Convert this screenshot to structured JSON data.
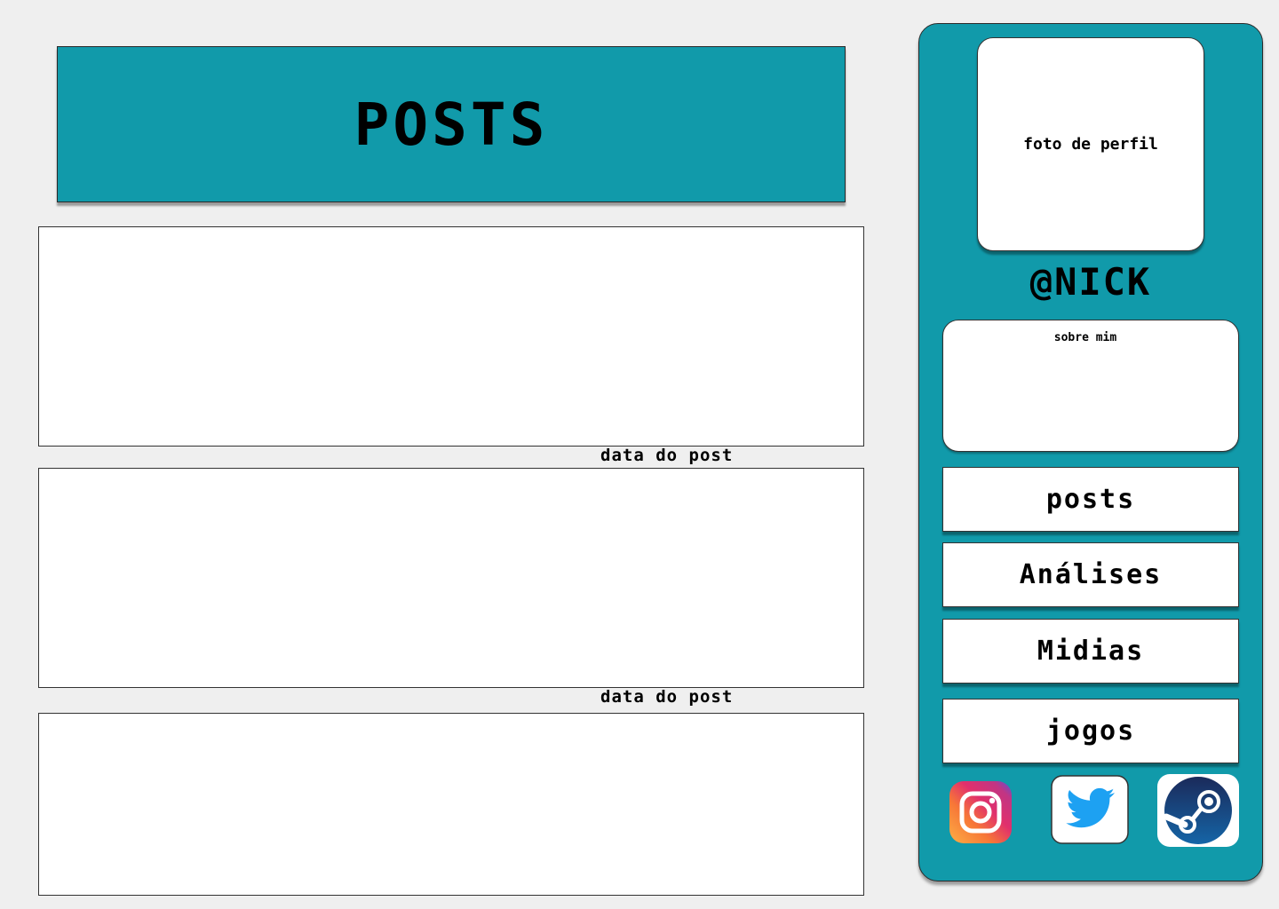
{
  "header": {
    "title": "POSTS"
  },
  "posts": [
    {
      "date": "data do post"
    },
    {
      "date": "data do post"
    },
    {
      "date": ""
    }
  ],
  "profile": {
    "photo_label": "foto de perfil",
    "nick": "@NICK",
    "about_title": "sobre mim"
  },
  "nav": {
    "posts": "posts",
    "analises": "Análises",
    "midias": "Midias",
    "jogos": "jogos"
  },
  "social": [
    "instagram-icon",
    "twitter-icon",
    "steam-icon"
  ],
  "colors": {
    "accent": "#119aaa",
    "card": "#ffffff",
    "background": "#efefef"
  }
}
